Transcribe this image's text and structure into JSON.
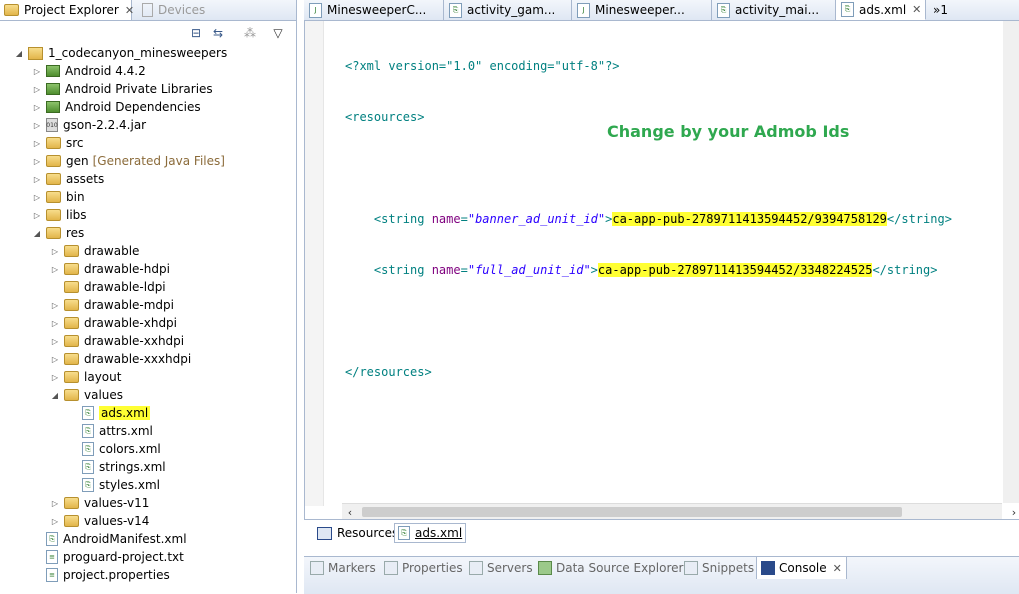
{
  "left_panel": {
    "tabs": [
      {
        "label": "Project Explorer",
        "active": true
      },
      {
        "label": "Devices",
        "active": false
      }
    ],
    "tree": [
      {
        "label": "1_codecanyon_minesweepers",
        "indent": 0,
        "twisty": "expanded",
        "icon": "project"
      },
      {
        "label": "Android 4.4.2",
        "indent": 1,
        "twisty": "collapsed",
        "icon": "library"
      },
      {
        "label": "Android Private Libraries",
        "indent": 1,
        "twisty": "collapsed",
        "icon": "library"
      },
      {
        "label": "Android Dependencies",
        "indent": 1,
        "twisty": "collapsed",
        "icon": "library"
      },
      {
        "label": "gson-2.2.4.jar",
        "indent": 1,
        "twisty": "collapsed",
        "icon": "jar"
      },
      {
        "label": "src",
        "indent": 1,
        "twisty": "collapsed",
        "icon": "package-folder"
      },
      {
        "label": "gen",
        "decoration": "[Generated Java Files]",
        "indent": 1,
        "twisty": "collapsed",
        "icon": "package-folder"
      },
      {
        "label": "assets",
        "indent": 1,
        "twisty": "collapsed",
        "icon": "folder"
      },
      {
        "label": "bin",
        "indent": 1,
        "twisty": "collapsed",
        "icon": "folder"
      },
      {
        "label": "libs",
        "indent": 1,
        "twisty": "collapsed",
        "icon": "folder"
      },
      {
        "label": "res",
        "indent": 1,
        "twisty": "expanded",
        "icon": "folder"
      },
      {
        "label": "drawable",
        "indent": 2,
        "twisty": "collapsed",
        "icon": "folder"
      },
      {
        "label": "drawable-hdpi",
        "indent": 2,
        "twisty": "collapsed",
        "icon": "folder"
      },
      {
        "label": "drawable-ldpi",
        "indent": 2,
        "twisty": "none",
        "icon": "folder"
      },
      {
        "label": "drawable-mdpi",
        "indent": 2,
        "twisty": "collapsed",
        "icon": "folder"
      },
      {
        "label": "drawable-xhdpi",
        "indent": 2,
        "twisty": "collapsed",
        "icon": "folder"
      },
      {
        "label": "drawable-xxhdpi",
        "indent": 2,
        "twisty": "collapsed",
        "icon": "folder"
      },
      {
        "label": "drawable-xxxhdpi",
        "indent": 2,
        "twisty": "collapsed",
        "icon": "folder"
      },
      {
        "label": "layout",
        "indent": 2,
        "twisty": "collapsed",
        "icon": "folder"
      },
      {
        "label": "values",
        "indent": 2,
        "twisty": "expanded",
        "icon": "folder"
      },
      {
        "label": "ads.xml",
        "indent": 3,
        "twisty": "none",
        "icon": "xml-file",
        "highlight": true
      },
      {
        "label": "attrs.xml",
        "indent": 3,
        "twisty": "none",
        "icon": "xml-file"
      },
      {
        "label": "colors.xml",
        "indent": 3,
        "twisty": "none",
        "icon": "xml-file"
      },
      {
        "label": "strings.xml",
        "indent": 3,
        "twisty": "none",
        "icon": "xml-file"
      },
      {
        "label": "styles.xml",
        "indent": 3,
        "twisty": "none",
        "icon": "xml-file"
      },
      {
        "label": "values-v11",
        "indent": 2,
        "twisty": "collapsed",
        "icon": "folder"
      },
      {
        "label": "values-v14",
        "indent": 2,
        "twisty": "collapsed",
        "icon": "folder"
      },
      {
        "label": "AndroidManifest.xml",
        "indent": 1,
        "twisty": "none",
        "icon": "xml-file"
      },
      {
        "label": "proguard-project.txt",
        "indent": 1,
        "twisty": "none",
        "icon": "text-file"
      },
      {
        "label": "project.properties",
        "indent": 1,
        "twisty": "none",
        "icon": "text-file"
      }
    ]
  },
  "editor": {
    "tabs": [
      {
        "label": "MinesweeperC...",
        "active": false
      },
      {
        "label": "activity_gam...",
        "active": false
      },
      {
        "label": "Minesweeper...",
        "active": false
      },
      {
        "label": "activity_mai...",
        "active": false
      },
      {
        "label": "ads.xml",
        "active": true
      }
    ],
    "overflow_label": "»1",
    "code": {
      "prolog": "<?xml version=\"1.0\" encoding=\"utf-8\"?>",
      "open_resources": "<resources>",
      "close_resources": "</resources>",
      "string1_name": "\"banner_ad_unit_id\"",
      "string1_value": "ca-app-pub-2789711413594452/9394758129",
      "string2_name": "\"full_ad_unit_id\"",
      "string2_value": "ca-app-pub-2789711413594452/3348224525"
    },
    "annotation": "Change by your Admob Ids",
    "bottom_tabs": [
      {
        "label": "Resources",
        "active": false
      },
      {
        "label": "ads.xml",
        "active": true
      }
    ]
  },
  "bottom_views": [
    {
      "label": "Markers",
      "active": false
    },
    {
      "label": "Properties",
      "active": false
    },
    {
      "label": "Servers",
      "active": false
    },
    {
      "label": "Data Source Explorer",
      "active": false
    },
    {
      "label": "Snippets",
      "active": false
    },
    {
      "label": "Console",
      "active": true
    }
  ],
  "colors": {
    "highlight": "#ffff33",
    "annotation": "#2fa84f",
    "xml_tag": "#008080",
    "xml_attr": "#7f007f",
    "xml_string": "#2a00ff"
  }
}
